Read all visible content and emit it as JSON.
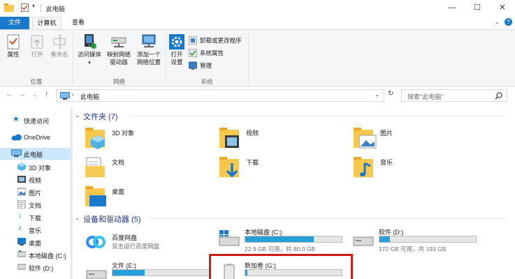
{
  "window": {
    "title": "此电脑",
    "controls": {
      "minimize": "—",
      "maximize": "☐",
      "close": "✕"
    }
  },
  "ribbon_tabs": [
    "文件",
    "计算机",
    "查看"
  ],
  "ribbon": {
    "groups": [
      {
        "label": "位置",
        "buttons": [
          "属性",
          "打开",
          "重命名"
        ]
      },
      {
        "label": "网络",
        "buttons": [
          "访问媒体",
          "映射网络驱动器",
          "添加一个网络位置"
        ]
      },
      {
        "label": "系统",
        "buttons": [
          "打开设置"
        ],
        "small_buttons": [
          "卸载或更改程序",
          "系统属性",
          "管理"
        ]
      }
    ]
  },
  "address_bar": {
    "path": "此电脑",
    "search_placeholder": "搜索\"此电脑\""
  },
  "nav_pane": [
    {
      "label": "快速访问",
      "icon": "star-icon"
    },
    {
      "label": "OneDrive",
      "icon": "cloud-icon"
    },
    {
      "label": "此电脑",
      "icon": "pc-icon",
      "selected": true
    },
    {
      "label": "3D 对象",
      "icon": "cube-icon"
    },
    {
      "label": "视频",
      "icon": "video-icon"
    },
    {
      "label": "图片",
      "icon": "picture-icon"
    },
    {
      "label": "文档",
      "icon": "document-icon"
    },
    {
      "label": "下载",
      "icon": "download-icon"
    },
    {
      "label": "音乐",
      "icon": "music-icon"
    },
    {
      "label": "桌面",
      "icon": "desktop-icon"
    },
    {
      "label": "本地磁盘 (C:)",
      "icon": "drive-icon"
    },
    {
      "label": "软件 (D:)",
      "icon": "drive-icon"
    }
  ],
  "folders_section": {
    "title": "文件夹 (7)",
    "items": [
      {
        "name": "3D 对象",
        "icon": "cube-folder-icon"
      },
      {
        "name": "视频",
        "icon": "video-folder-icon"
      },
      {
        "name": "图片",
        "icon": "picture-folder-icon"
      },
      {
        "name": "文档",
        "icon": "document-folder-icon"
      },
      {
        "name": "下载",
        "icon": "download-folder-icon"
      },
      {
        "name": "音乐",
        "icon": "music-folder-icon"
      },
      {
        "name": "桌面",
        "icon": "desktop-folder-icon"
      }
    ]
  },
  "devices_section": {
    "title": "设备和驱动器 (5)",
    "items": [
      {
        "name": "百度网盘",
        "info": "双击运行百度网盘",
        "icon": "baidu-netdisk-icon"
      },
      {
        "name": "本地磁盘 (C:)",
        "info": "22.9 GB 可用，共 80.0 GB",
        "used": 0.71,
        "icon": "windows-drive-icon"
      },
      {
        "name": "软件 (D:)",
        "info": "172 GB 可用，共 193 GB",
        "used": 0.11,
        "icon": "drive-icon"
      },
      {
        "name": "文件 (E:)",
        "info": "",
        "used": 0.33,
        "icon": "drive-icon"
      },
      {
        "name": "新加卷 (G:)",
        "info": "",
        "used": 0.02,
        "icon": "usb-drive-icon"
      }
    ]
  },
  "colors": {
    "accent": "#1979ca",
    "selection": "#cce8ff",
    "usage_bar": "#26a0da",
    "highlight": "#d11b1b"
  }
}
